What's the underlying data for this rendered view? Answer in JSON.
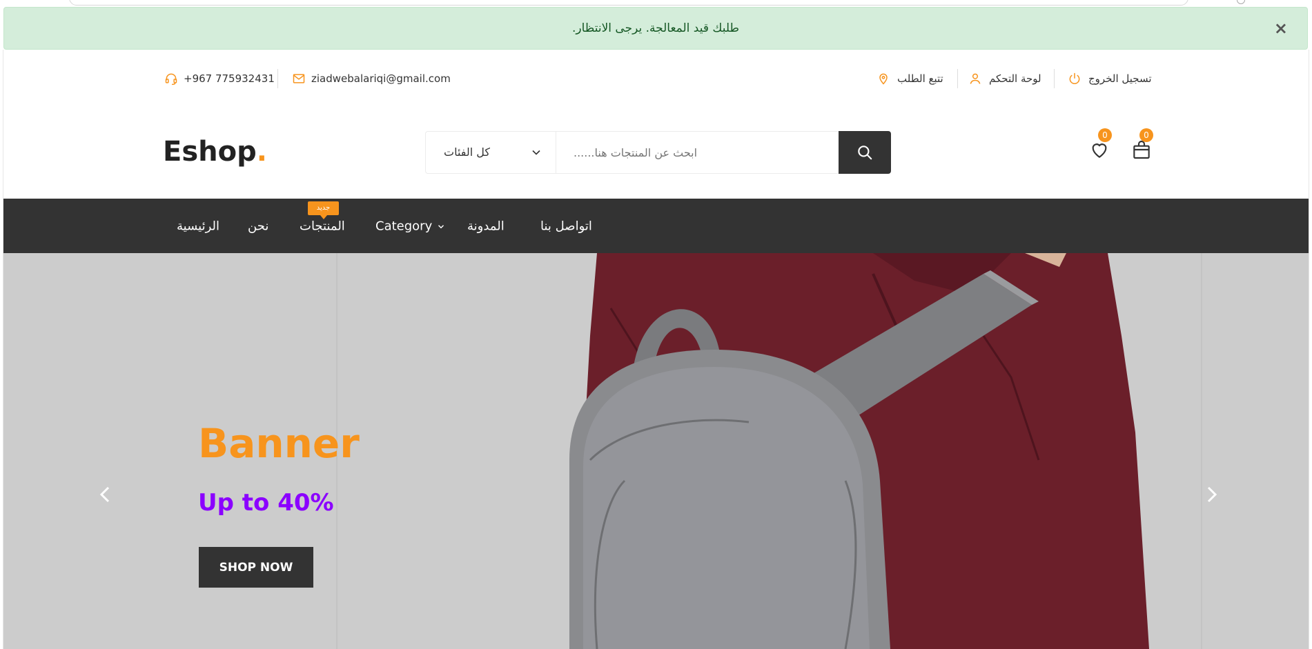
{
  "alert": {
    "message": ".طلبك قيد المعالجة. يرجى الانتظار",
    "close_symbol": "×"
  },
  "topbar": {
    "phone": "+967 775932431",
    "email": "ziadwebalariqi@gmail.com",
    "links": {
      "track_order": "تتبع الطلب",
      "dashboard": "لوحة التحكم",
      "logout": "تسجيل الخروج"
    },
    "icons": [
      "headset-icon",
      "mail-icon",
      "location-pin-icon",
      "user-icon",
      "power-icon"
    ]
  },
  "header": {
    "logo_text": "Eshop",
    "logo_dot": ".",
    "category_select": "كل الفئات",
    "search_placeholder": "......ابحث عن المنتجات هنا",
    "wishlist_count": "0",
    "cart_count": "0"
  },
  "nav": {
    "items": {
      "home": "الرئيسية",
      "about": "نحن",
      "products": "المنتجات",
      "category": "Category",
      "blog": "المدونة",
      "contact": "اتواصل بنا"
    },
    "new_badge": "جديد"
  },
  "hero": {
    "title": "Banner",
    "subtitle": "Up to 40%",
    "cta": "SHOP NOW"
  },
  "colors": {
    "accent": "#f7941d",
    "dark": "#333333",
    "purple": "#8b00ff",
    "alert_bg": "#d4edda",
    "alert_text": "#155724"
  }
}
